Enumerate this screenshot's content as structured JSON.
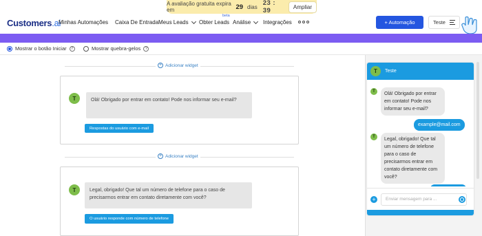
{
  "trial": {
    "text_before": "A avaliação gratuita expira em",
    "days": "29",
    "days_label": "dias",
    "time": "23 : 39",
    "button": "Ampliar"
  },
  "brand": {
    "name": "Customers",
    "suffix": ".ai",
    "color": "#1b2f86"
  },
  "nav": {
    "items": [
      "Minhas Automações",
      "Caixa De Entrada",
      "Meus Leads",
      "Obter Leads",
      "Análise",
      "Integrações"
    ],
    "beta_badge": "beta",
    "more_icon": "more-dots-icon"
  },
  "actions": {
    "automation_button": "+ Automação",
    "test_button": "Teste"
  },
  "options": {
    "show_start_button": "Mostrar o botão Iniciar",
    "show_icebreakers": "Mostrar quebra-gelos",
    "help_glyph": "?"
  },
  "canvas": {
    "add_widget_label": "Adicionar widget",
    "add_widget_icon": "+",
    "cards": [
      {
        "avatar": "T",
        "message": "Olá! Obrigado por entrar em contato! Pode nos informar seu e-mail?",
        "button": "Respostas do usuário com e-mail"
      },
      {
        "avatar": "T",
        "message": "Legal, obrigado! Que tal um número de telefone para o caso de precisarmos entrar em contato diretamente com você?",
        "button": "O usuário responde com número de telefone"
      }
    ]
  },
  "chat": {
    "title": "Teste",
    "avatar": "T",
    "messages": [
      {
        "from": "bot",
        "text": "Olá! Obrigado por entrar em contato! Pode nos informar seu e-mail?"
      },
      {
        "from": "user",
        "text": "example@mail.com"
      },
      {
        "from": "bot",
        "text": "Legal, obrigado! Que tal um número de telefone para o caso de precisarmos entrar em contato diretamente com você?"
      }
    ],
    "input_placeholder": "Enviar mensagem para ...",
    "add_icon": "+"
  },
  "colors": {
    "accent": "#2456e0",
    "purple_band": "#7c5cf2",
    "chat_blue": "#1b9be0",
    "trial_bg": "#fbecac",
    "avatar_green": "#7ebd4a"
  }
}
